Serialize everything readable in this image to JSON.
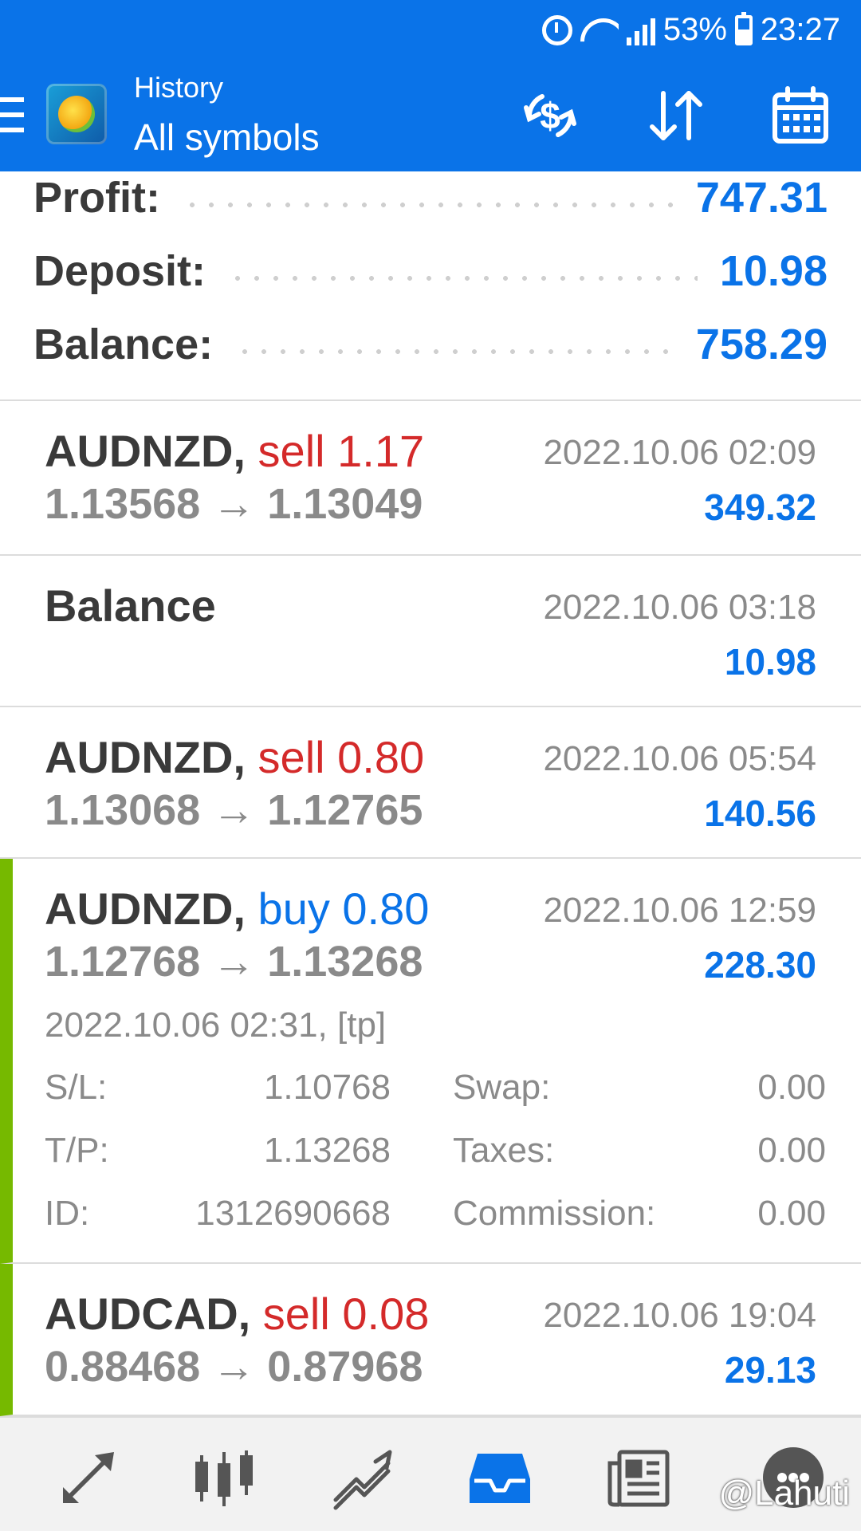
{
  "status_bar": {
    "battery": "53%",
    "time": "23:27"
  },
  "header": {
    "subtitle": "History",
    "title": "All symbols",
    "icons": [
      "deposit-withdraw-icon",
      "sort-icon",
      "calendar-icon"
    ]
  },
  "summary": {
    "profit_label": "Profit:",
    "profit_value": "747.31",
    "deposit_label": "Deposit:",
    "deposit_value": "10.98",
    "balance_label": "Balance:",
    "balance_value": "758.29"
  },
  "deals": [
    {
      "symbol": "AUDNZD",
      "sep": ",",
      "action": "sell 1.17",
      "type": "sell",
      "date": "2022.10.06 02:09",
      "prices": "1.13568 → 1.13049",
      "profit": "349.32"
    },
    {
      "symbol": "Balance",
      "date": "2022.10.06 03:18",
      "profit": "10.98"
    },
    {
      "symbol": "AUDNZD",
      "sep": ",",
      "action": "sell 0.80",
      "type": "sell",
      "date": "2022.10.06 05:54",
      "prices": "1.13068 → 1.12765",
      "profit": "140.56"
    },
    {
      "symbol": "AUDNZD",
      "sep": ",",
      "action": "buy 0.80",
      "type": "buy",
      "date": "2022.10.06 12:59",
      "prices": "1.12768 → 1.13268",
      "profit": "228.30",
      "details": {
        "open_time": "2022.10.06 02:31, [tp]",
        "sl_label": "S/L:",
        "sl_value": "1.10768",
        "tp_label": "T/P:",
        "tp_value": "1.13268",
        "id_label": "ID:",
        "id_value": "1312690668",
        "swap_label": "Swap:",
        "swap_value": "0.00",
        "taxes_label": "Taxes:",
        "taxes_value": "0.00",
        "commission_label": "Commission:",
        "commission_value": "0.00"
      }
    },
    {
      "symbol": "AUDCAD",
      "sep": ",",
      "action": "sell 0.08",
      "type": "sell",
      "date": "2022.10.06 19:04",
      "prices": "0.88468 → 0.87968",
      "profit": "29.13"
    }
  ],
  "bottom_nav": {
    "items": [
      "quotes-icon",
      "chart-icon",
      "trade-icon",
      "history-icon",
      "news-icon",
      "chat-icon"
    ],
    "active": "history-icon"
  },
  "watermark": "@Lahuti",
  "colors": {
    "accent": "#0a73e8",
    "sell": "#d42a2a",
    "selected_bar": "#76b900"
  }
}
